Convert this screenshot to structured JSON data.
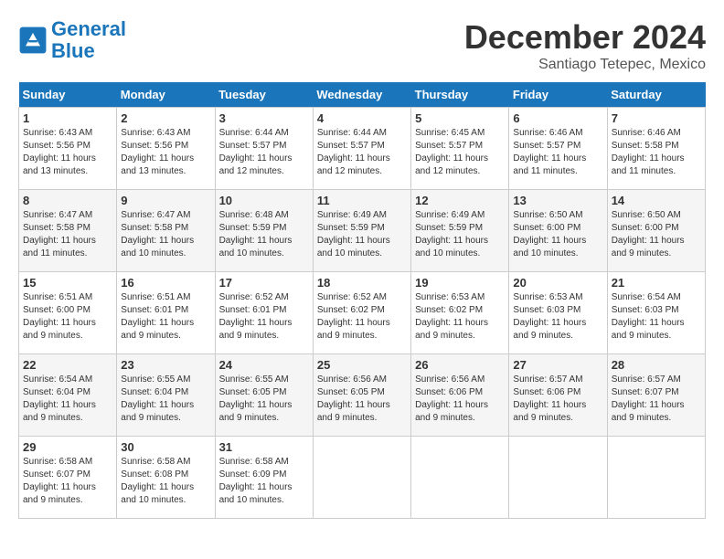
{
  "header": {
    "logo_line1": "General",
    "logo_line2": "Blue",
    "month": "December 2024",
    "location": "Santiago Tetepec, Mexico"
  },
  "weekdays": [
    "Sunday",
    "Monday",
    "Tuesday",
    "Wednesday",
    "Thursday",
    "Friday",
    "Saturday"
  ],
  "weeks": [
    [
      {
        "day": "1",
        "sunrise": "6:43 AM",
        "sunset": "5:56 PM",
        "daylight": "11 hours and 13 minutes."
      },
      {
        "day": "2",
        "sunrise": "6:43 AM",
        "sunset": "5:56 PM",
        "daylight": "11 hours and 13 minutes."
      },
      {
        "day": "3",
        "sunrise": "6:44 AM",
        "sunset": "5:57 PM",
        "daylight": "11 hours and 12 minutes."
      },
      {
        "day": "4",
        "sunrise": "6:44 AM",
        "sunset": "5:57 PM",
        "daylight": "11 hours and 12 minutes."
      },
      {
        "day": "5",
        "sunrise": "6:45 AM",
        "sunset": "5:57 PM",
        "daylight": "11 hours and 12 minutes."
      },
      {
        "day": "6",
        "sunrise": "6:46 AM",
        "sunset": "5:57 PM",
        "daylight": "11 hours and 11 minutes."
      },
      {
        "day": "7",
        "sunrise": "6:46 AM",
        "sunset": "5:58 PM",
        "daylight": "11 hours and 11 minutes."
      }
    ],
    [
      {
        "day": "8",
        "sunrise": "6:47 AM",
        "sunset": "5:58 PM",
        "daylight": "11 hours and 11 minutes."
      },
      {
        "day": "9",
        "sunrise": "6:47 AM",
        "sunset": "5:58 PM",
        "daylight": "11 hours and 10 minutes."
      },
      {
        "day": "10",
        "sunrise": "6:48 AM",
        "sunset": "5:59 PM",
        "daylight": "11 hours and 10 minutes."
      },
      {
        "day": "11",
        "sunrise": "6:49 AM",
        "sunset": "5:59 PM",
        "daylight": "11 hours and 10 minutes."
      },
      {
        "day": "12",
        "sunrise": "6:49 AM",
        "sunset": "5:59 PM",
        "daylight": "11 hours and 10 minutes."
      },
      {
        "day": "13",
        "sunrise": "6:50 AM",
        "sunset": "6:00 PM",
        "daylight": "11 hours and 10 minutes."
      },
      {
        "day": "14",
        "sunrise": "6:50 AM",
        "sunset": "6:00 PM",
        "daylight": "11 hours and 9 minutes."
      }
    ],
    [
      {
        "day": "15",
        "sunrise": "6:51 AM",
        "sunset": "6:00 PM",
        "daylight": "11 hours and 9 minutes."
      },
      {
        "day": "16",
        "sunrise": "6:51 AM",
        "sunset": "6:01 PM",
        "daylight": "11 hours and 9 minutes."
      },
      {
        "day": "17",
        "sunrise": "6:52 AM",
        "sunset": "6:01 PM",
        "daylight": "11 hours and 9 minutes."
      },
      {
        "day": "18",
        "sunrise": "6:52 AM",
        "sunset": "6:02 PM",
        "daylight": "11 hours and 9 minutes."
      },
      {
        "day": "19",
        "sunrise": "6:53 AM",
        "sunset": "6:02 PM",
        "daylight": "11 hours and 9 minutes."
      },
      {
        "day": "20",
        "sunrise": "6:53 AM",
        "sunset": "6:03 PM",
        "daylight": "11 hours and 9 minutes."
      },
      {
        "day": "21",
        "sunrise": "6:54 AM",
        "sunset": "6:03 PM",
        "daylight": "11 hours and 9 minutes."
      }
    ],
    [
      {
        "day": "22",
        "sunrise": "6:54 AM",
        "sunset": "6:04 PM",
        "daylight": "11 hours and 9 minutes."
      },
      {
        "day": "23",
        "sunrise": "6:55 AM",
        "sunset": "6:04 PM",
        "daylight": "11 hours and 9 minutes."
      },
      {
        "day": "24",
        "sunrise": "6:55 AM",
        "sunset": "6:05 PM",
        "daylight": "11 hours and 9 minutes."
      },
      {
        "day": "25",
        "sunrise": "6:56 AM",
        "sunset": "6:05 PM",
        "daylight": "11 hours and 9 minutes."
      },
      {
        "day": "26",
        "sunrise": "6:56 AM",
        "sunset": "6:06 PM",
        "daylight": "11 hours and 9 minutes."
      },
      {
        "day": "27",
        "sunrise": "6:57 AM",
        "sunset": "6:06 PM",
        "daylight": "11 hours and 9 minutes."
      },
      {
        "day": "28",
        "sunrise": "6:57 AM",
        "sunset": "6:07 PM",
        "daylight": "11 hours and 9 minutes."
      }
    ],
    [
      {
        "day": "29",
        "sunrise": "6:58 AM",
        "sunset": "6:07 PM",
        "daylight": "11 hours and 9 minutes."
      },
      {
        "day": "30",
        "sunrise": "6:58 AM",
        "sunset": "6:08 PM",
        "daylight": "11 hours and 10 minutes."
      },
      {
        "day": "31",
        "sunrise": "6:58 AM",
        "sunset": "6:09 PM",
        "daylight": "11 hours and 10 minutes."
      },
      null,
      null,
      null,
      null
    ]
  ]
}
